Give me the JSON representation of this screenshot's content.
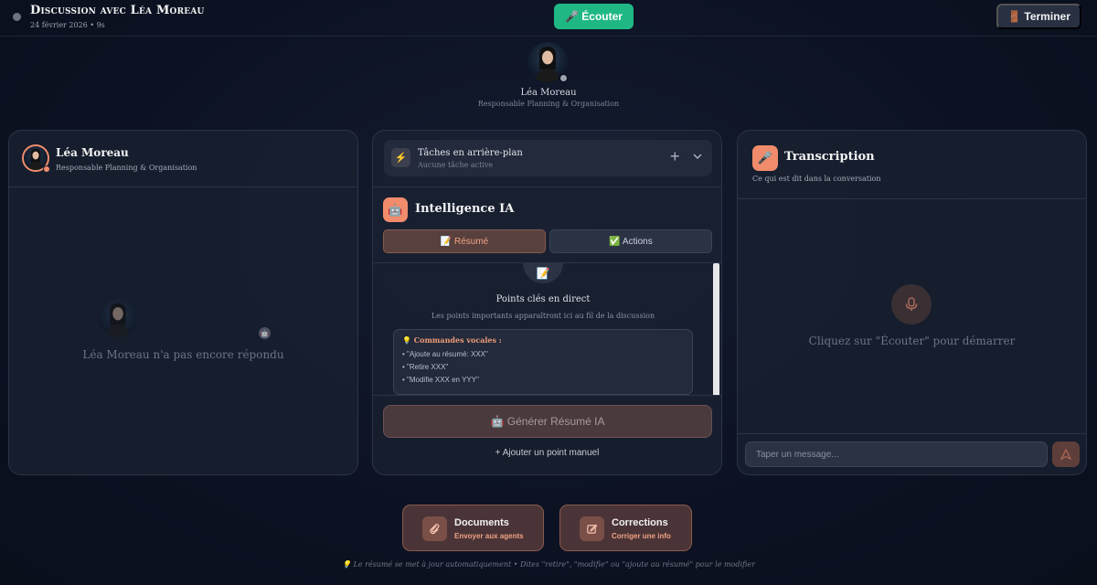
{
  "header": {
    "title": "Discussion avec Léa Moreau",
    "subtitle": "24 février 2026 • 9s",
    "listen_label": "🎤 Écouter",
    "end_label": "🚪 Terminer"
  },
  "participant": {
    "name": "Léa Moreau",
    "role": "Responsable Planning & Organisation"
  },
  "left_panel": {
    "name": "Léa Moreau",
    "role": "Responsable Planning & Organisation",
    "empty_text": "Léa Moreau n'a pas encore répondu"
  },
  "middle_panel": {
    "bg_tasks_title": "Tâches en arrière-plan",
    "bg_tasks_sub": "Aucune tâche active",
    "ia_title": "Intelligence IA",
    "tabs": [
      {
        "label": "📝 Résumé",
        "active": true
      },
      {
        "label": "✅ Actions",
        "active": false
      }
    ],
    "key_points_title": "Points clés en direct",
    "key_points_sub": "Les points importants apparaîtront ici au fil de la discussion",
    "commands_title": "💡 Commandes vocales :",
    "commands": [
      "• \"Ajoute au résumé: XXX\"",
      "• \"Retire XXX\"",
      "• \"Modifie XXX en YYY\""
    ],
    "generate_label": "🤖 Générer Résumé IA",
    "add_manual_label": "+  Ajouter un point manuel"
  },
  "right_panel": {
    "title": "Transcription",
    "subtitle": "Ce qui est dit dans la conversation",
    "empty_text": "Cliquez sur \"Écouter\" pour démarrer",
    "input_placeholder": "Taper un message..."
  },
  "cards": [
    {
      "title": "Documents",
      "sub": "Envoyer aux agents"
    },
    {
      "title": "Corrections",
      "sub": "Corriger une info"
    }
  ],
  "footer": "💡 Le résumé se met à jour automatiquement • Dites \"retire\", \"modifie\" ou \"ajoute au résumé\" pour le modifier",
  "colors": {
    "accent": "#f08c6c",
    "listen_green": "#1fb885",
    "background": "#0c1222"
  },
  "icons": {
    "listen": "microphone-icon",
    "end": "door-icon",
    "bg_tasks": "lightning-icon",
    "ia": "robot-icon",
    "transcription": "microphone-icon",
    "documents": "paperclip-icon",
    "corrections": "edit-icon",
    "send": "send-icon"
  }
}
